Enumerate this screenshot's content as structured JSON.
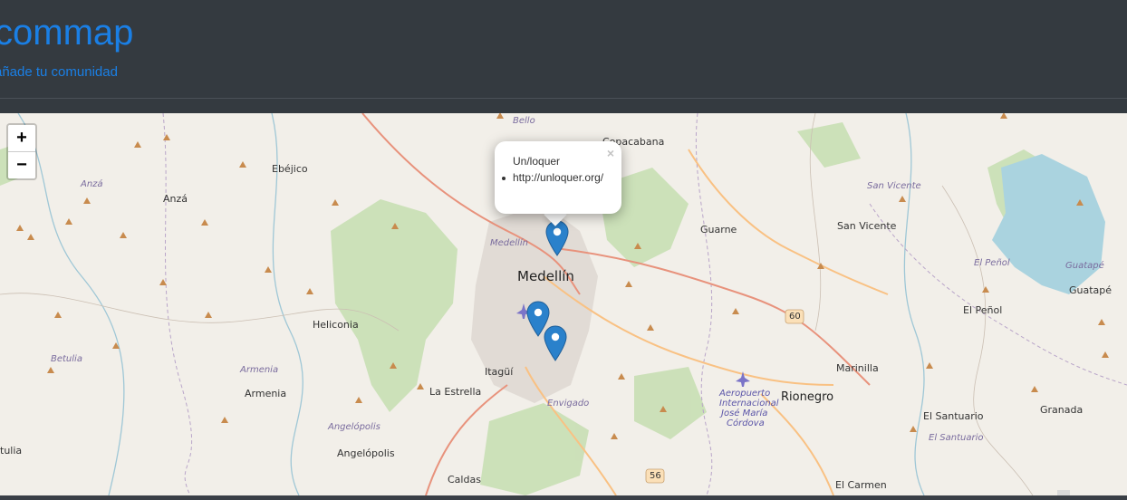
{
  "header": {
    "brand": "commap",
    "tagline": "añade tu comunidad"
  },
  "map": {
    "zoom_in": "+",
    "zoom_out": "−",
    "popup": {
      "title": "Un/loquer",
      "url": "http://unloquer.org/",
      "close": "×"
    },
    "places": {
      "medellin": "Medellín",
      "rionegro": "Rionegro",
      "bello": "Bello",
      "copacabana": "Copacabana",
      "ebejico": "Ebéjico",
      "anza_town": "Anzá",
      "anza_region": "Anzá",
      "san_vicente_region": "San Vicente",
      "san_vicente": "San Vicente",
      "guarne": "Guarne",
      "medellin_region": "Medellín",
      "el_penol_region": "El Peñol",
      "guatape_region": "Guatapé",
      "guatape": "Guatapé",
      "el_penol": "El Peñol",
      "heliconia": "Heliconia",
      "betulia": "Betulia",
      "armenia_region": "Armenia",
      "armenia": "Armenia",
      "itagui": "Itagüí",
      "la_estrella": "La Estrella",
      "aeropuerto": [
        "Aeropuerto",
        "Internacional",
        "José María",
        "Córdova"
      ],
      "marinilla": "Marinilla",
      "envigado": "Envigado",
      "el_santuario": "El Santuario",
      "el_santuario_region": "El Santuario",
      "granada": "Granada",
      "angelopolis_region": "Angelópolis",
      "angelopolis": "Angelópolis",
      "betulia_town": "tulia",
      "caldas": "Caldas",
      "el_carmen": "El Carmen",
      "road_60": "60",
      "road_56": "56"
    }
  },
  "colors": {
    "brand": "#1a7fe5",
    "header_bg": "#343a40",
    "map_bg": "#f2efe9",
    "marker": "#2a81cb"
  }
}
